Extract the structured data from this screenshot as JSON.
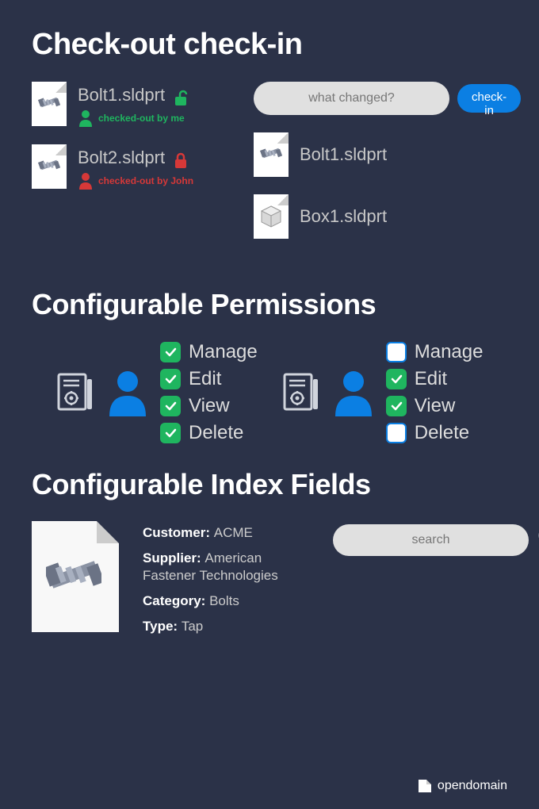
{
  "section1": {
    "title": "Check-out check-in",
    "left_files": [
      {
        "name": "Bolt1.sldprt",
        "lock": "unlocked",
        "status": "checked-out by me",
        "who": "me"
      },
      {
        "name": "Bolt2.sldprt",
        "lock": "locked",
        "status": "checked-out by John",
        "who": "other"
      }
    ],
    "input_placeholder": "what changed?",
    "checkin_label": "check-in",
    "right_files": [
      {
        "name": "Bolt1.sldprt",
        "type": "bolt"
      },
      {
        "name": "Box1.sldprt",
        "type": "box"
      }
    ]
  },
  "section2": {
    "title": "Configurable Permissions",
    "perm_labels": [
      "Manage",
      "Edit",
      "View",
      "Delete"
    ],
    "user1_perms": [
      true,
      true,
      true,
      true
    ],
    "user2_perms": [
      false,
      true,
      true,
      false
    ]
  },
  "section3": {
    "title": "Configurable Index Fields",
    "fields": [
      {
        "label": "Customer:",
        "value": "ACME"
      },
      {
        "label": "Supplier:",
        "value": "American Fastener Technologies"
      },
      {
        "label": "Category:",
        "value": "Bolts"
      },
      {
        "label": "Type:",
        "value": "Tap"
      }
    ],
    "search_placeholder": "search"
  },
  "footer": {
    "brand": "opendomain"
  }
}
